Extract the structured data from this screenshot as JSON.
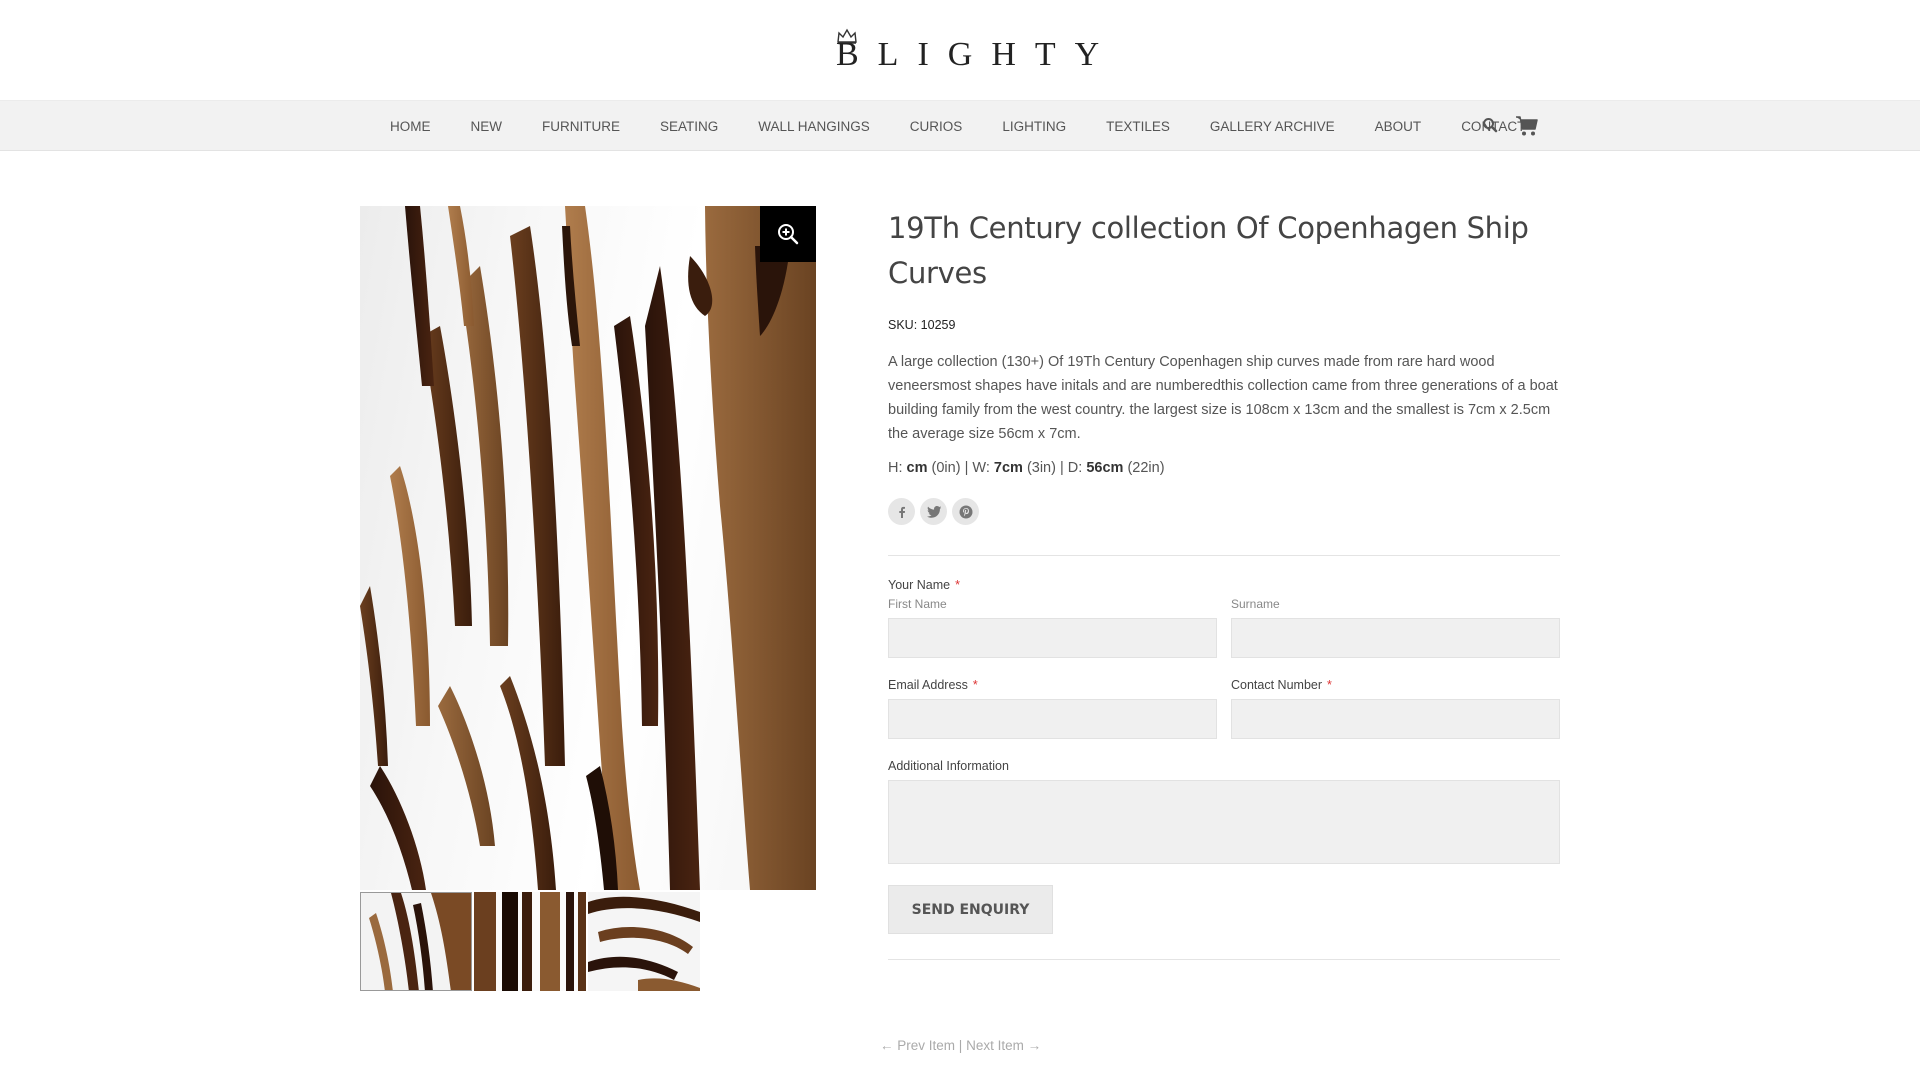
{
  "brand": {
    "logo_text": "BLIGHTY",
    "logo_icon": "crown-icon"
  },
  "nav": {
    "items": [
      {
        "label": "HOME"
      },
      {
        "label": "NEW"
      },
      {
        "label": "FURNITURE"
      },
      {
        "label": "SEATING"
      },
      {
        "label": "WALL HANGINGS"
      },
      {
        "label": "CURIOS"
      },
      {
        "label": "LIGHTING"
      },
      {
        "label": "TEXTILES"
      },
      {
        "label": "GALLERY ARCHIVE"
      },
      {
        "label": "ABOUT"
      },
      {
        "label": "CONTACT"
      }
    ],
    "icons": [
      "search-icon",
      "cart-icon"
    ]
  },
  "gallery": {
    "zoom_icon": "zoom-in-icon",
    "thumbnail_count": 3
  },
  "product": {
    "title": "19Th Century collection Of Copenhagen Ship Curves",
    "sku_label": "SKU:",
    "sku": "10259",
    "description": "A large collection (130+) Of 19Th Century Copenhagen ship curves made from rare hard wood veneersmost shapes have initals and are numberedthis collection came from three generations of a boat building family from the west country. the largest size is 108cm x 13cm and the smallest is 7cm x 2.5cm the average size 56cm x 7cm.",
    "dimensions": {
      "h_label": "H:",
      "h_cm": "cm",
      "h_in": "(0in)",
      "w_label": "W:",
      "w_cm": "7cm",
      "w_in": "(3in)",
      "d_label": "D:",
      "d_cm": "56cm",
      "d_in": "(22in)",
      "separator": "|"
    },
    "social_icons": [
      "facebook-icon",
      "twitter-icon",
      "pinterest-icon"
    ]
  },
  "form": {
    "name_label": "Your Name",
    "first_name_sublabel": "First Name",
    "surname_sublabel": "Surname",
    "email_label": "Email Address",
    "contact_label": "Contact Number",
    "additional_label": "Additional Information",
    "required_mark": "*",
    "submit_label": "SEND ENQUIRY"
  },
  "pager": {
    "prev_label": "Prev Item",
    "separator": "|",
    "next_label": "Next Item"
  },
  "colors": {
    "nav_bg": "#f2f2f2",
    "field_bg": "#f0f0f0",
    "required": "#dd3333",
    "zoom_bg": "#000000"
  }
}
